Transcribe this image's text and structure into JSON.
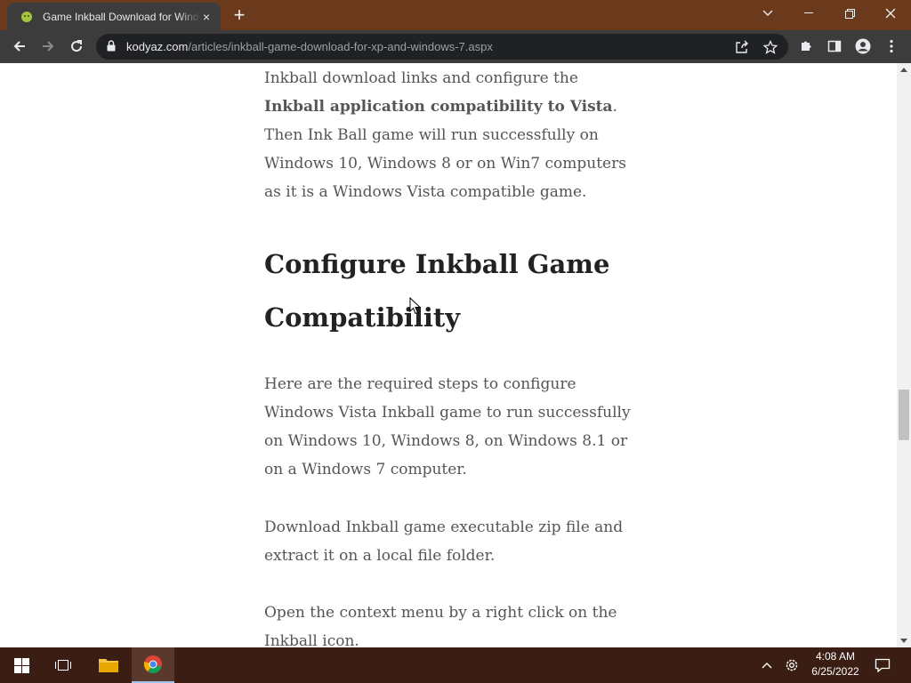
{
  "browser": {
    "tab_title": "Game Inkball Download for Windows 7",
    "tab_close": "×",
    "new_tab": "+",
    "url_host": "kodyaz.com",
    "url_path": "/articles/inkball-game-download-for-xp-and-windows-7.aspx",
    "accent": "#6b3a1c",
    "toolbar_bg": "#3c3c3c"
  },
  "article": {
    "p1_text_a": "Inkball download links and configure the ",
    "p1_bold": "Inkball application compatibility to Vista",
    "p1_text_b": ".",
    "p1_text_c": "Then Ink Ball game will run successfully on Windows 10, Windows 8 or on Win7 computers as it is a Windows Vista compatible game.",
    "heading": "Configure Inkball Game Compatibility",
    "p2": "Here are the required steps to configure Windows Vista Inkball game to run successfully on Windows 10, Windows 8, on Windows 8.1 or on a Windows 7 computer.",
    "p3": "Download Inkball game executable zip file and extract it on a local file folder.",
    "p4": "Open the context menu by a right click on the Inkball icon."
  },
  "taskbar": {
    "time": "4:08 AM",
    "date": "6/25/2022",
    "icons": [
      "windows-start-icon",
      "task-view-icon",
      "file-explorer-icon",
      "chrome-icon"
    ]
  }
}
